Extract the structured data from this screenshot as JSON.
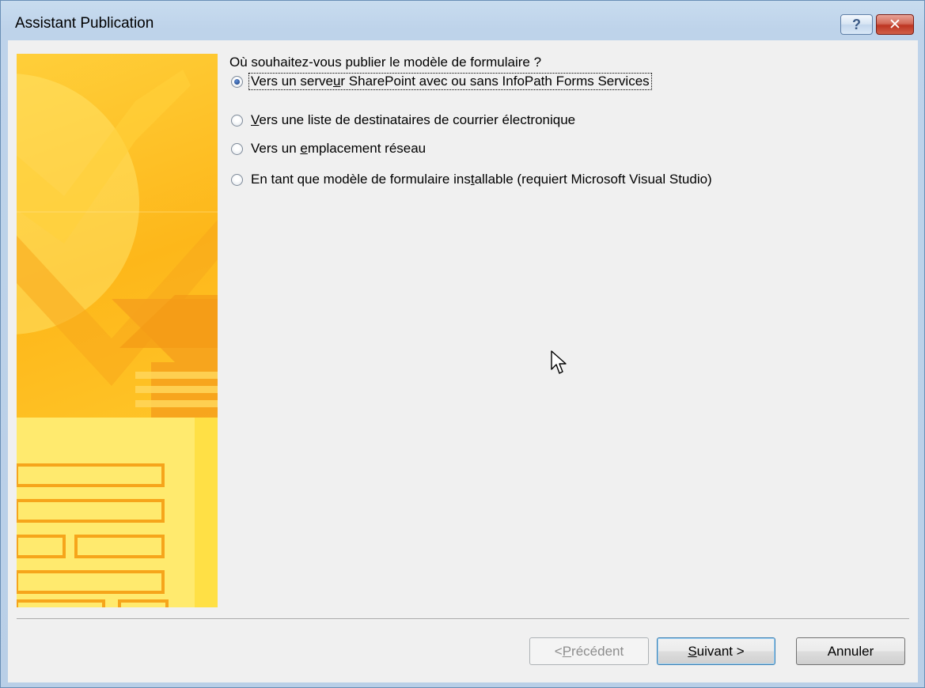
{
  "window": {
    "title": "Assistant Publication",
    "help_label": "?",
    "close_label": "✕"
  },
  "main": {
    "question": "Où souhaitez-vous publier le modèle de formulaire ?",
    "options": [
      {
        "pre": "Vers un serve",
        "accel": "u",
        "post": "r SharePoint avec ou sans InfoPath Forms Services",
        "checked": true
      },
      {
        "pre": "",
        "accel": "V",
        "post": "ers une liste de destinataires de courrier électronique",
        "checked": false
      },
      {
        "pre": "Vers un ",
        "accel": "e",
        "post": "mplacement réseau",
        "checked": false
      },
      {
        "pre": "En tant que modèle de formulaire ins",
        "accel": "t",
        "post": "allable (requiert Microsoft Visual Studio)",
        "checked": false
      }
    ]
  },
  "buttons": {
    "previous": {
      "pre": "< ",
      "accel": "P",
      "post": "récédent",
      "enabled": false
    },
    "next": {
      "pre": "",
      "accel": "S",
      "post": "uivant >",
      "enabled": true
    },
    "cancel": {
      "label": "Annuler"
    }
  },
  "colors": {
    "sidebar_orange": "#fdb71a",
    "sidebar_yellow": "#ffd84a",
    "close_red": "#c8432d"
  }
}
